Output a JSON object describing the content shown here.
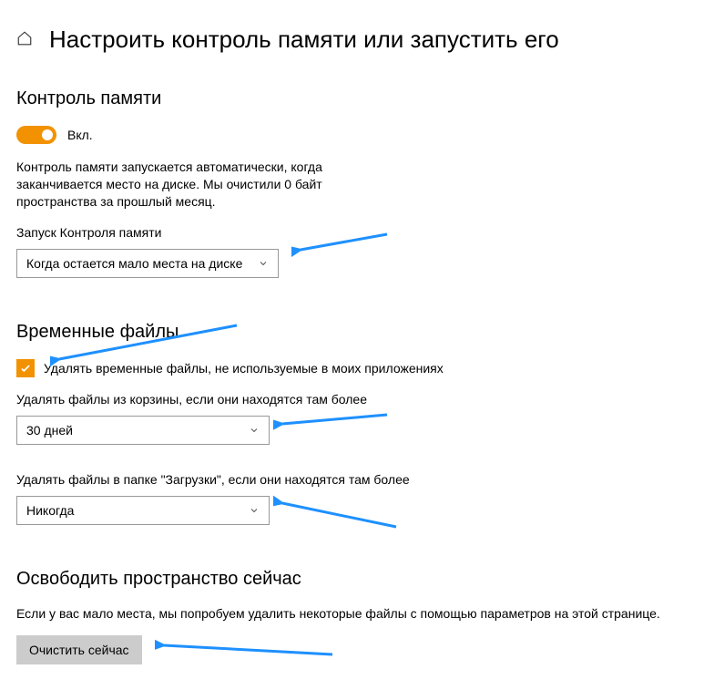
{
  "header": {
    "title": "Настроить контроль памяти или запустить его"
  },
  "storage": {
    "section_title": "Контроль памяти",
    "toggle_label": "Вкл.",
    "description": "Контроль памяти запускается автоматически, когда заканчивается место на диске. Мы очистили 0 байт пространства за прошлый месяц.",
    "run_label": "Запуск Контроля памяти",
    "run_value": "Когда остается мало места на диске"
  },
  "temp": {
    "section_title": "Временные файлы",
    "checkbox_label": "Удалять временные файлы, не используемые в моих приложениях",
    "recycle_label": "Удалять файлы из корзины, если они находятся там более",
    "recycle_value": "30 дней",
    "downloads_label": "Удалять файлы в папке \"Загрузки\", если они находятся там более",
    "downloads_value": "Никогда"
  },
  "freeup": {
    "section_title": "Освободить пространство сейчас",
    "description": "Если у вас мало места, мы попробуем удалить некоторые файлы с помощью параметров на этой странице.",
    "button_label": "Очистить сейчас"
  }
}
